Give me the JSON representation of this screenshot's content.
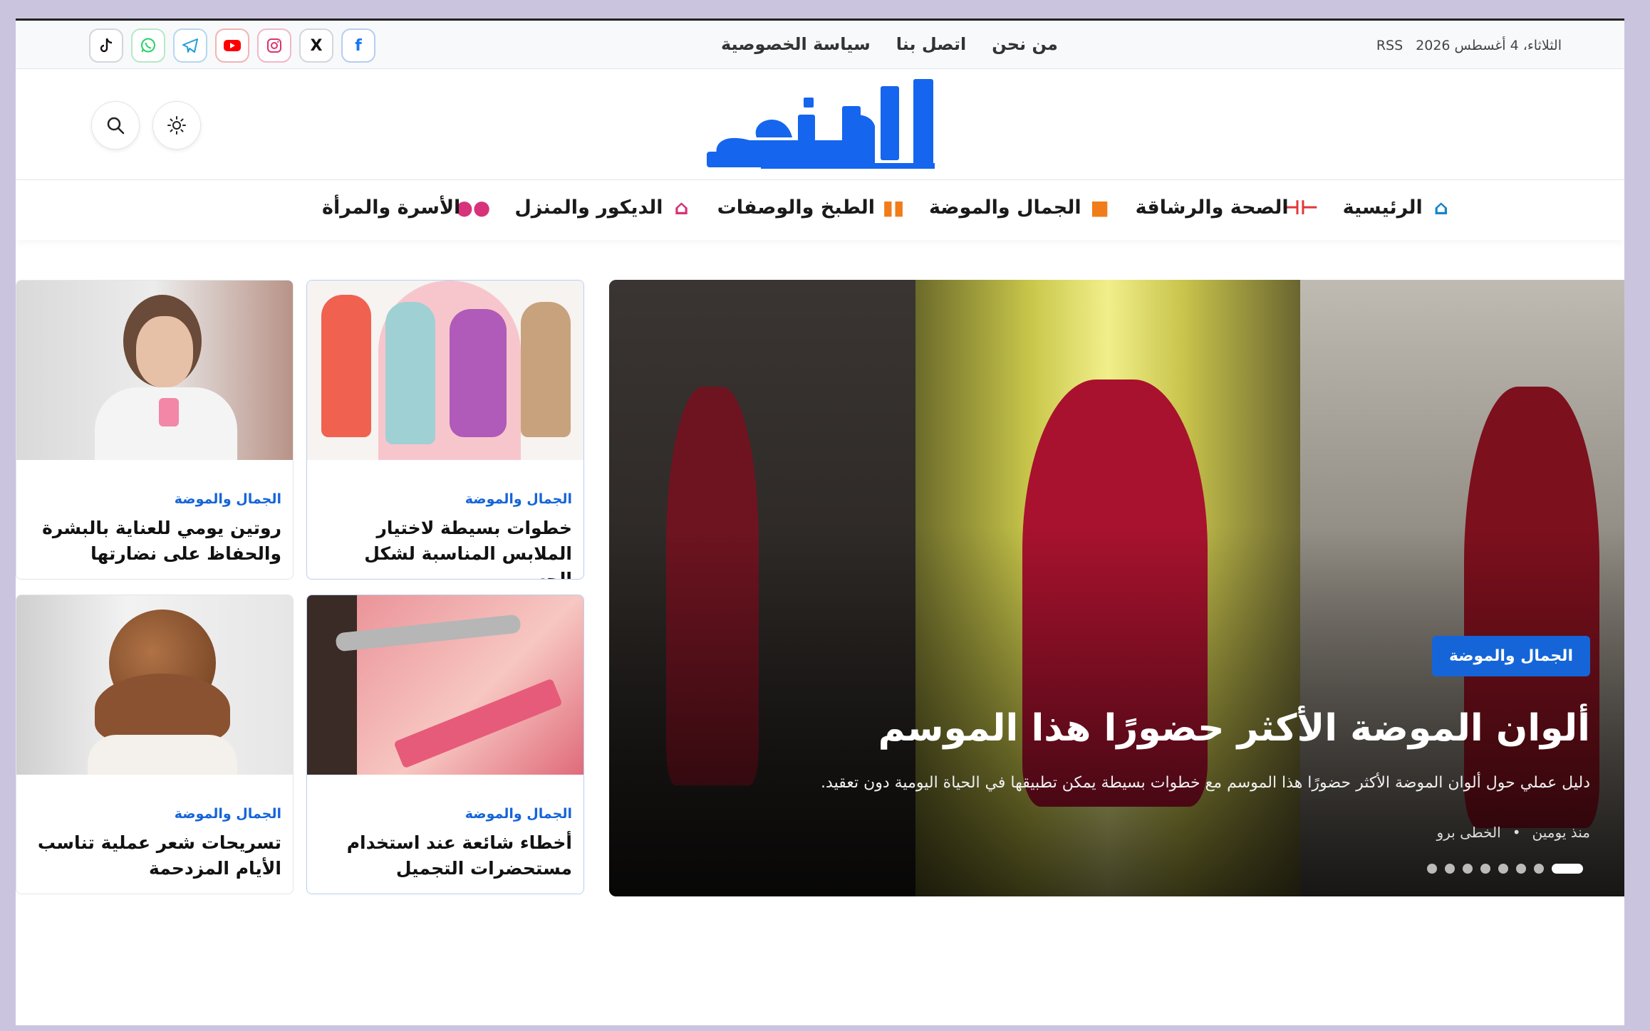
{
  "topbar": {
    "date": "الثلاثاء، 4 أغسطس 2026",
    "rss": "RSS",
    "links": [
      "من نحن",
      "اتصل بنا",
      "سياسة الخصوصية"
    ],
    "social": [
      "facebook-icon",
      "x-icon",
      "instagram-icon",
      "youtube-icon",
      "telegram-icon",
      "whatsapp-icon",
      "tiktok-icon"
    ]
  },
  "header": {
    "logo_text": "الخطى"
  },
  "nav": {
    "items": [
      {
        "label": "الرئيسية",
        "icon": "home-icon",
        "color": "#1786c9"
      },
      {
        "label": "الصحة والرشاقة",
        "icon": "dumbbell-icon",
        "color": "#e2363a"
      },
      {
        "label": "الجمال والموضة",
        "icon": "bag-icon",
        "color": "#f07c1a"
      },
      {
        "label": "الطبخ والوصفات",
        "icon": "book-icon",
        "color": "#f07c1a"
      },
      {
        "label": "الديكور والمنزل",
        "icon": "house-icon",
        "color": "#d6337a"
      },
      {
        "label": "الأسرة والمرأة",
        "icon": "users-icon",
        "color": "#d6337a"
      }
    ]
  },
  "hero": {
    "category": "الجمال والموضة",
    "title": "ألوان الموضة الأكثر حضورًا هذا الموسم",
    "description": "دليل عملي حول ألوان الموضة الأكثر حضورًا هذا الموسم مع خطوات بسيطة يمكن تطبيقها في الحياة اليومية دون تعقيد.",
    "time": "منذ يومين",
    "author": "الخطى برو",
    "separator": "•"
  },
  "cards": [
    {
      "category": "الجمال والموضة",
      "title": "خطوات بسيطة لاختيار الملابس المناسبة لشكل الجسم"
    },
    {
      "category": "الجمال والموضة",
      "title": "روتين يومي للعناية بالبشرة والحفاظ على نضارتها"
    },
    {
      "category": "الجمال والموضة",
      "title": "أخطاء شائعة عند استخدام مستحضرات التجميل"
    },
    {
      "category": "الجمال والموضة",
      "title": "تسريحات شعر عملية تناسب الأيام المزدحمة"
    }
  ],
  "accent_color": "#1565d8"
}
